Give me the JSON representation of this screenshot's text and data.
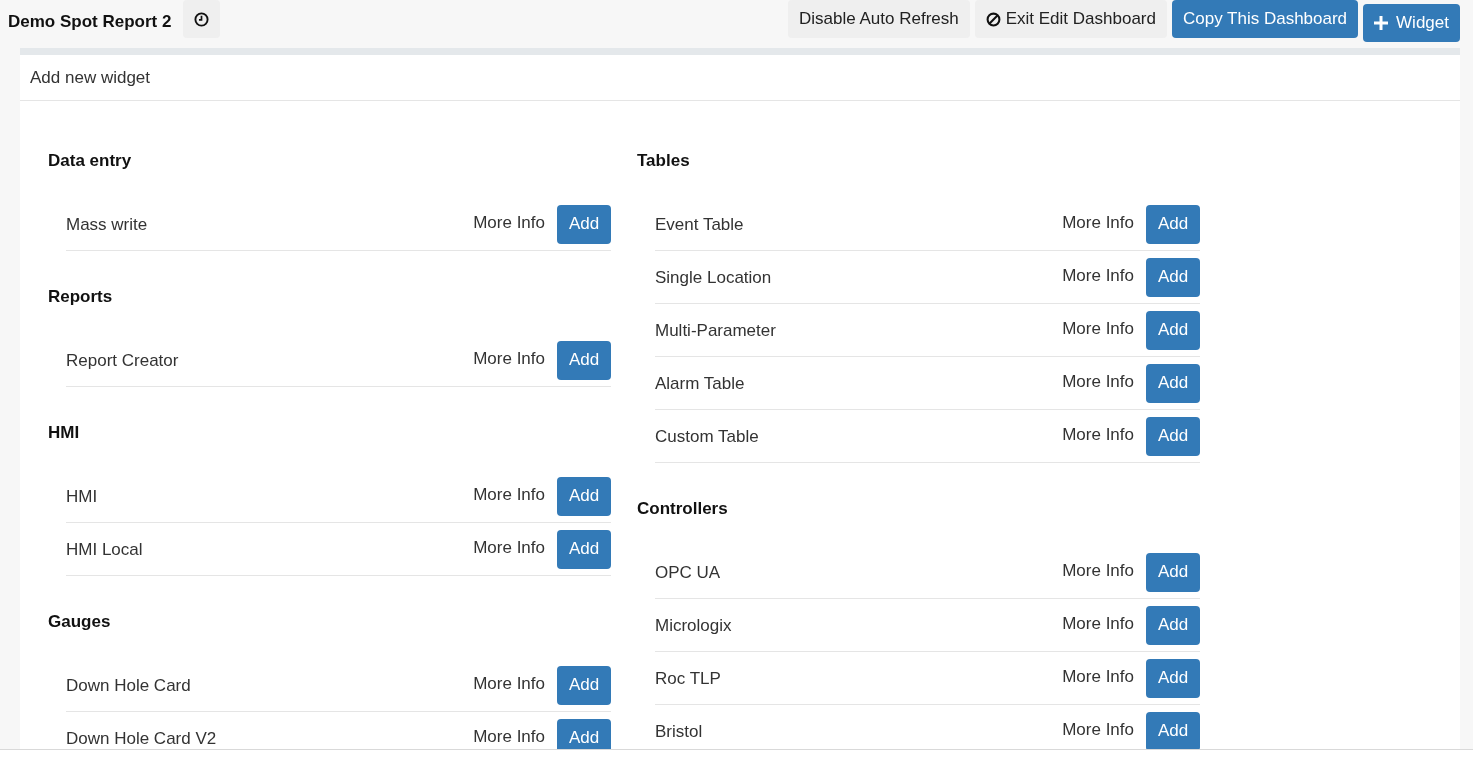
{
  "header": {
    "title": "Demo Spot Report 2",
    "buttons": [
      {
        "kind": "plain",
        "label": "Disable Auto Refresh"
      },
      {
        "kind": "ban",
        "label": "Exit Edit Dashboard"
      },
      {
        "kind": "primary",
        "label": "Copy This Dashboard"
      },
      {
        "kind": "plus",
        "label": "Widget"
      }
    ]
  },
  "panel": {
    "title": "Add new widget",
    "columns": [
      [
        {
          "heading": "Data entry",
          "items": [
            {
              "name": "Mass write",
              "more_info": "More Info",
              "add": "Add"
            }
          ]
        },
        {
          "heading": "Reports",
          "items": [
            {
              "name": "Report Creator",
              "more_info": "More Info",
              "add": "Add"
            }
          ]
        },
        {
          "heading": "HMI",
          "items": [
            {
              "name": "HMI",
              "more_info": "More Info",
              "add": "Add"
            },
            {
              "name": "HMI Local",
              "more_info": "More Info",
              "add": "Add"
            }
          ]
        },
        {
          "heading": "Gauges",
          "items": [
            {
              "name": "Down Hole Card",
              "more_info": "More Info",
              "add": "Add"
            },
            {
              "name": "Down Hole Card V2",
              "more_info": "More Info",
              "add": "Add"
            }
          ]
        }
      ],
      [
        {
          "heading": "Tables",
          "items": [
            {
              "name": "Event Table",
              "more_info": "More Info",
              "add": "Add"
            },
            {
              "name": "Single Location",
              "more_info": "More Info",
              "add": "Add"
            },
            {
              "name": "Multi-Parameter",
              "more_info": "More Info",
              "add": "Add"
            },
            {
              "name": "Alarm Table",
              "more_info": "More Info",
              "add": "Add"
            },
            {
              "name": "Custom Table",
              "more_info": "More Info",
              "add": "Add"
            }
          ]
        },
        {
          "heading": "Controllers",
          "items": [
            {
              "name": "OPC UA",
              "more_info": "More Info",
              "add": "Add"
            },
            {
              "name": "Micrologix",
              "more_info": "More Info",
              "add": "Add"
            },
            {
              "name": "Roc TLP",
              "more_info": "More Info",
              "add": "Add"
            },
            {
              "name": "Bristol",
              "more_info": "More Info",
              "add": "Add"
            }
          ]
        }
      ]
    ]
  }
}
